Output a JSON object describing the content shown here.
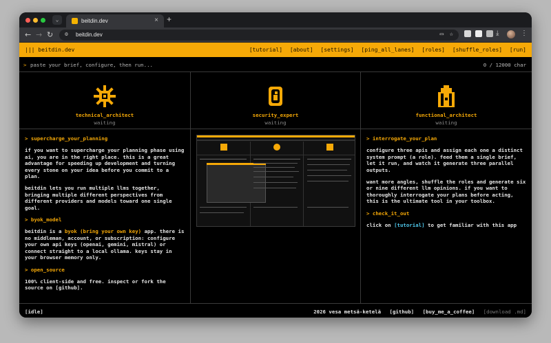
{
  "browser": {
    "tab_title": "beitdin.dev",
    "url": "beitdin.dev"
  },
  "colors": {
    "accent": "#f6a907",
    "link": "#4ec6ea",
    "background": "#000000"
  },
  "appbar": {
    "brand": "beitdin.dev",
    "links": [
      "[tutorial]",
      "[about]",
      "[settings]",
      "[ping_all_lanes]",
      "[roles]",
      "[shuffle_roles]",
      "[run]"
    ]
  },
  "prompt": {
    "arrow": ">",
    "placeholder": "paste your brief, configure, then run...",
    "count": "0 / 12000 char"
  },
  "roles": [
    {
      "name": "technical_architect",
      "status": "waiting",
      "icon": "gear-icon"
    },
    {
      "name": "security_expert",
      "status": "waiting",
      "icon": "lock-icon"
    },
    {
      "name": "functional_architect",
      "status": "waiting",
      "icon": "tower-icon"
    }
  ],
  "left": {
    "h1": "> supercharge_your_planning",
    "p1": "if you want to supercharge your planning phase using ai, you are in the right place. this is a great advantage for speeding up development and turning every stone on your idea before you commit to a plan.",
    "p2": "beitdin lets you run multiple llms together, bringing multiple different perspectives from different providers and models toward one single goal.",
    "h2": "> byok_model",
    "p3a": "beitdin is a",
    "p3b": "byok (bring your own key)",
    "p3c": "app. there is no middleman, account, or subscription: configure your own api keys (openai, gemini, mistral) or connect straight to a local ollama. keys stay in your browser memory only.",
    "h3": "> open_source",
    "p4": "100% client-side and free. inspect or fork the source on [github]."
  },
  "right": {
    "h1": "> interrogate_your_plan",
    "p1": "configure three apis and assign each one a distinct system prompt (a role). feed them a single brief, let it run, and watch it generate three parallel outputs.",
    "p2": "want more angles, shuffle the roles and generate six or nine different llm opinions. if you want to thoroughly interrogate your plans before acting, this is the ultimate tool in your toolbox.",
    "h2": "> check_it_out",
    "p3a": "click on",
    "p3b": "[tutorial]",
    "p3c": "to get familiar with this app"
  },
  "footer": {
    "status": "[idle]",
    "credit": "2026 vesa metsä-ketelä",
    "github": "[github]",
    "coffee": "[buy_me_a_coffee]",
    "download": "[download .md]"
  }
}
